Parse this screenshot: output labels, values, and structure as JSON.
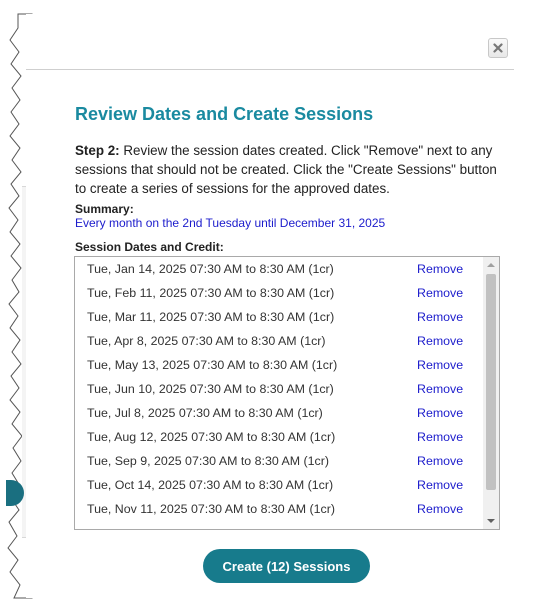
{
  "dialog": {
    "title": "Review Dates and Create Sessions",
    "step_label": "Step 2:",
    "step_text": " Review the session dates created. Click \"Remove\" next to any sessions that should not be created. Click the \"Create Sessions\" button to create a series of sessions for the approved dates.",
    "summary_label": "Summary:",
    "summary_value": "Every month on the 2nd Tuesday until December 31, 2025",
    "sessions_label": "Session Dates and Credit:",
    "remove_label": "Remove",
    "create_button_label": "Create (12) Sessions",
    "close_icon": "close-icon"
  },
  "sessions": [
    "Tue, Jan 14, 2025 07:30 AM to 8:30 AM (1cr)",
    "Tue, Feb 11, 2025 07:30 AM to 8:30 AM (1cr)",
    "Tue, Mar 11, 2025 07:30 AM to 8:30 AM (1cr)",
    "Tue, Apr 8, 2025 07:30 AM to 8:30 AM (1cr)",
    "Tue, May 13, 2025 07:30 AM to 8:30 AM (1cr)",
    "Tue, Jun 10, 2025 07:30 AM to 8:30 AM (1cr)",
    "Tue, Jul 8, 2025 07:30 AM to 8:30 AM (1cr)",
    "Tue, Aug 12, 2025 07:30 AM to 8:30 AM (1cr)",
    "Tue, Sep 9, 2025 07:30 AM to 8:30 AM (1cr)",
    "Tue, Oct 14, 2025 07:30 AM to 8:30 AM (1cr)",
    "Tue, Nov 11, 2025 07:30 AM to 8:30 AM (1cr)"
  ],
  "colors": {
    "title": "#1a8aa0",
    "link": "#1c1ccc",
    "button": "#177b8c"
  }
}
